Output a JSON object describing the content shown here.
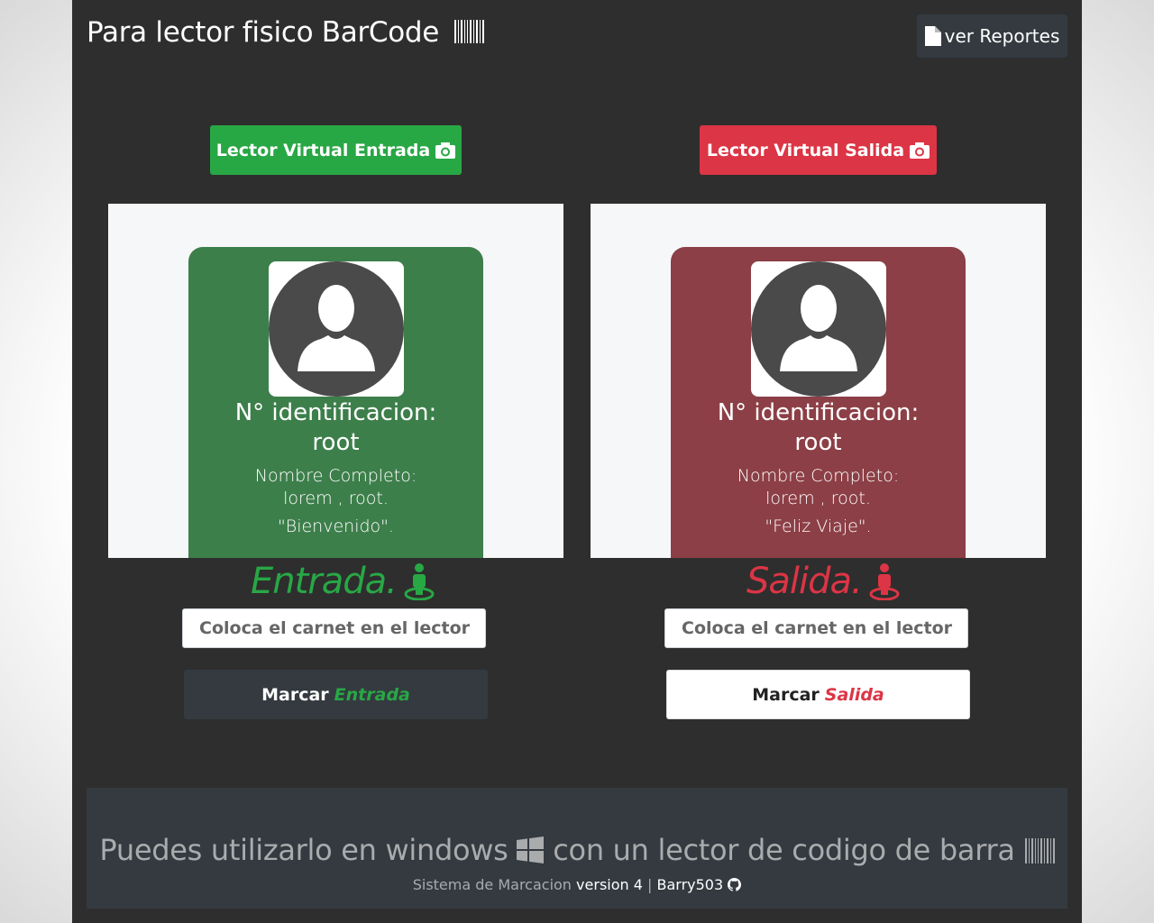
{
  "header": {
    "title": "Para lector fisico BarCode",
    "title_icon": "barcode-icon",
    "reports_button": "ver Reportes",
    "reports_icon": "file-icon"
  },
  "entrada": {
    "virtual_button": "Lector Virtual Entrada",
    "virtual_icon": "camera-icon",
    "card": {
      "id_label": "N° identificacion:",
      "id_value": "root",
      "name_label": "Nombre Completo:",
      "name_value": "lorem , root.",
      "message": "\"Bienvenido\"."
    },
    "status": "Entrada.",
    "status_icon": "street-view-icon",
    "input_placeholder": "Coloca el carnet en el lector",
    "mark_prefix": "Marcar",
    "mark_word": "Entrada",
    "color": "#28a745",
    "card_color": "#3d7f4b"
  },
  "salida": {
    "virtual_button": "Lector Virtual Salida",
    "virtual_icon": "camera-icon",
    "card": {
      "id_label": "N° identificacion:",
      "id_value": "root",
      "name_label": "Nombre Completo:",
      "name_value": "lorem , root.",
      "message": "\"Feliz Viaje\"."
    },
    "status": "Salida.",
    "status_icon": "street-view-icon",
    "input_placeholder": "Coloca el carnet en el lector",
    "mark_prefix": "Marcar",
    "mark_word": "Salida",
    "color": "#dc3545",
    "card_color": "#8c3f46"
  },
  "footer": {
    "text_part1": "Puedes utilizarlo en windows",
    "text_part2": "con un lector de codigo de barra",
    "system_label": "Sistema de Marcacion",
    "version": "version 4",
    "separator": "|",
    "author": "Barry503",
    "author_icon": "github-icon"
  }
}
